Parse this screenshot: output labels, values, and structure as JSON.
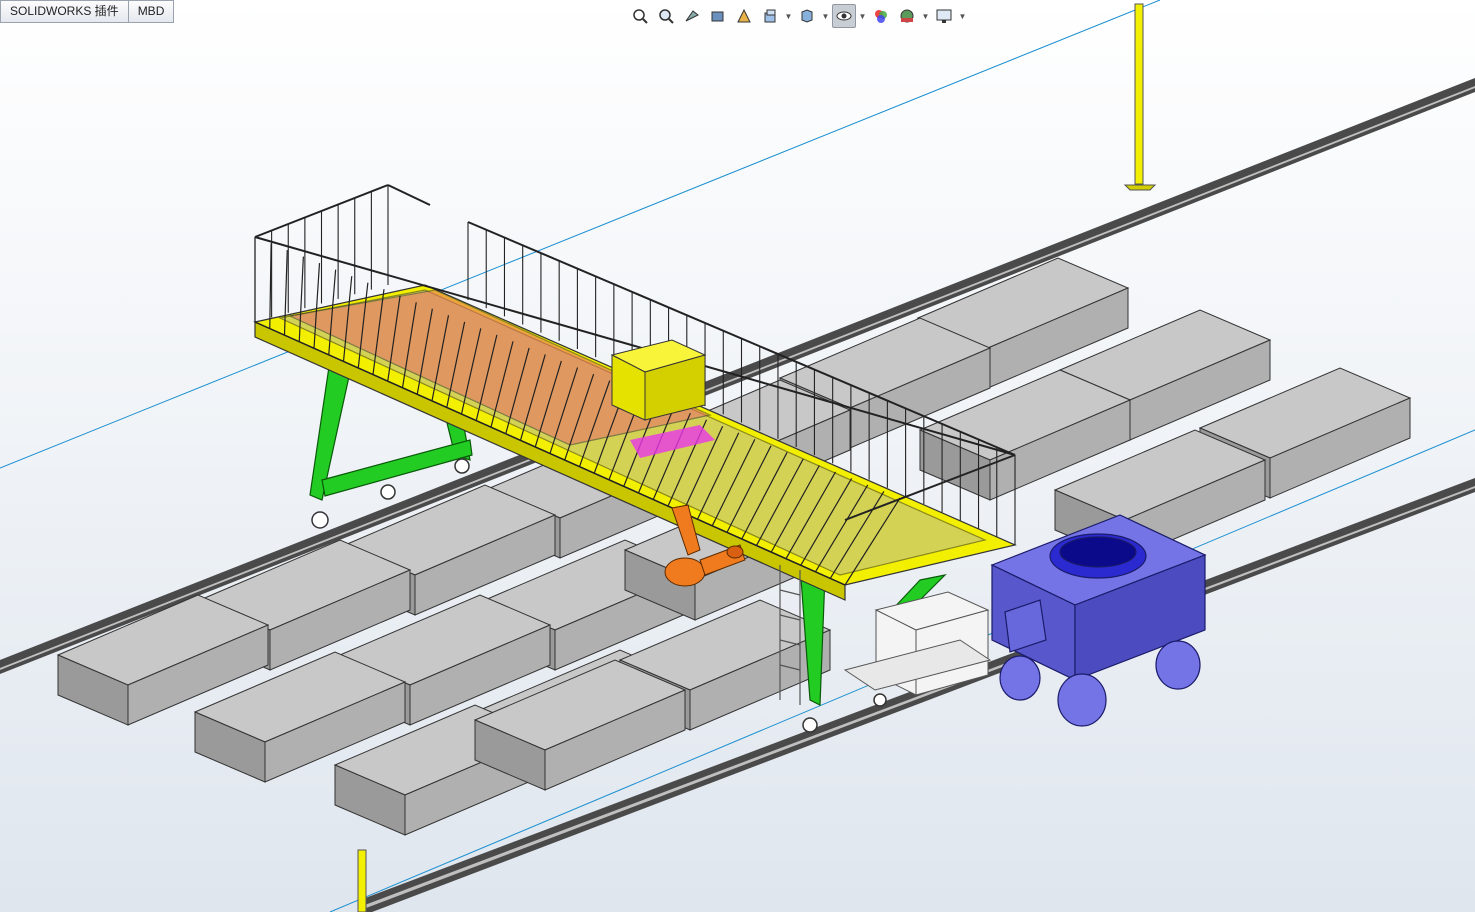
{
  "tabs": [
    {
      "label": "SOLIDWORKS 插件"
    },
    {
      "label": "MBD"
    }
  ],
  "hud": {
    "icons": [
      "zoom-to-fit-icon",
      "zoom-to-area-icon",
      "previous-view-icon",
      "section-view-icon",
      "dynamic-annotation-icon",
      "view-orientation-icon",
      "display-style-icon",
      "hide-show-items-icon",
      "edit-appearance-icon",
      "apply-scene-icon",
      "view-settings-icon"
    ]
  },
  "colors": {
    "frame": "#f2ef00",
    "legs": "#22cc22",
    "robot": "#f07a1e",
    "cart": "#5b5bd6",
    "slab": "#c8c8c8",
    "rail": "#3a3a3a",
    "hidden_blue": "#1a8fd0",
    "rack": "#d9604a"
  }
}
